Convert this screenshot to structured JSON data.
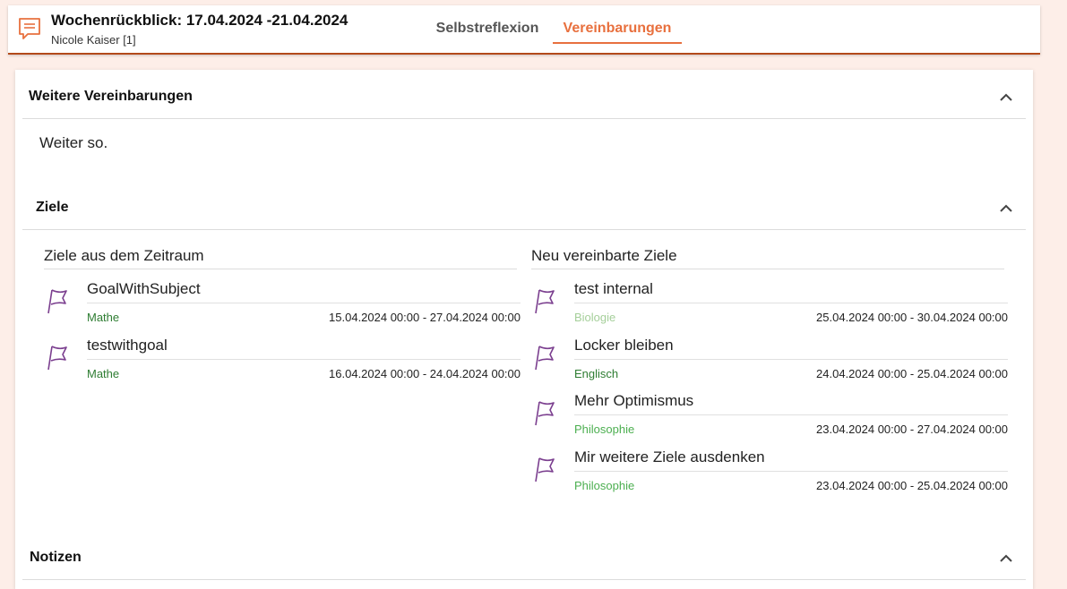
{
  "header": {
    "title": "Wochenrückblick: 17.04.2024 -21.04.2024",
    "subtitle": "Nicole Kaiser [1]",
    "icon": "comment-icon",
    "tabs": [
      {
        "label": "Selbstreflexion",
        "active": false
      },
      {
        "label": "Vereinbarungen",
        "active": true
      }
    ]
  },
  "sections": {
    "weitere": {
      "title": "Weitere Vereinbarungen",
      "text": "Weiter so."
    },
    "ziele": {
      "title": "Ziele"
    },
    "notizen": {
      "title": "Notizen"
    }
  },
  "ziele_zeitraum": {
    "title": "Ziele aus dem Zeitraum",
    "items": [
      {
        "name": "GoalWithSubject",
        "subject": "Mathe",
        "subject_color": "#2e7d32",
        "dates": "15.04.2024 00:00 - 27.04.2024 00:00"
      },
      {
        "name": "testwithgoal",
        "subject": "Mathe",
        "subject_color": "#2e7d32",
        "dates": "16.04.2024 00:00 - 24.04.2024 00:00"
      }
    ]
  },
  "ziele_neu": {
    "title": "Neu vereinbarte Ziele",
    "items": [
      {
        "name": "test internal",
        "subject": "Biologie",
        "subject_color": "#a5cf9a",
        "dates": "25.04.2024 00:00 - 30.04.2024 00:00"
      },
      {
        "name": "Locker bleiben",
        "subject": "Englisch",
        "subject_color": "#2e7d32",
        "dates": "24.04.2024 00:00 - 25.04.2024 00:00"
      },
      {
        "name": "Mehr Optimismus",
        "subject": "Philosophie",
        "subject_color": "#4caf50",
        "dates": "23.04.2024 00:00 - 27.04.2024 00:00"
      },
      {
        "name": "Mir weitere Ziele ausdenken",
        "subject": "Philosophie",
        "subject_color": "#4caf50",
        "dates": "23.04.2024 00:00 - 25.04.2024 00:00"
      }
    ]
  },
  "colors": {
    "accent": "#e8703e",
    "flag": "#7b3f8f",
    "header_border": "#b34a1a"
  }
}
